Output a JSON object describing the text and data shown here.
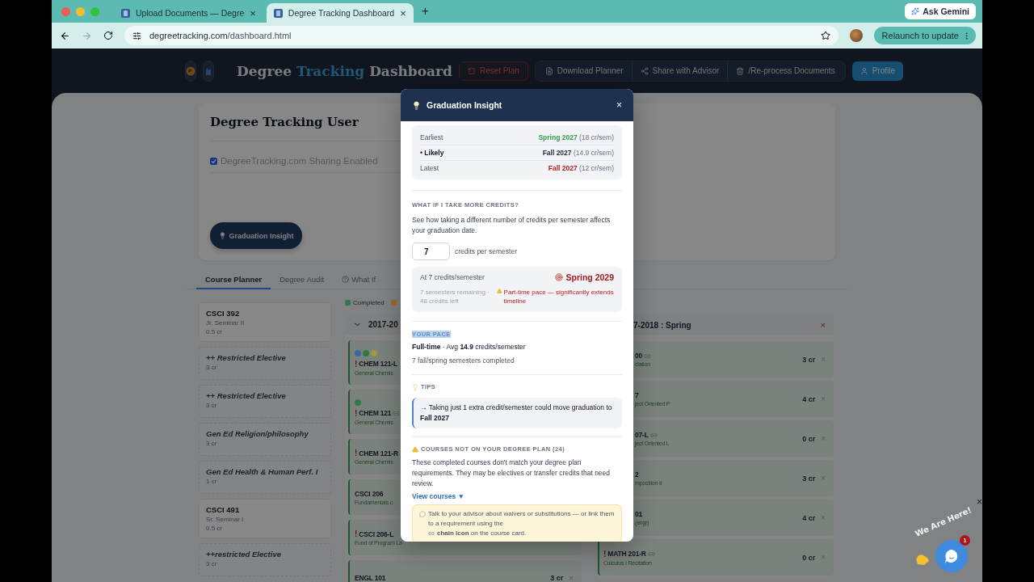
{
  "browser": {
    "tabs": [
      {
        "title": "Upload Documents — Degre",
        "close": "×",
        "selected": false
      },
      {
        "title": "Degree Tracking Dashboard",
        "close": "×",
        "selected": true
      }
    ],
    "new_tab": "+",
    "gemini": "Ask Gemini",
    "url_host": "degreetracking.com",
    "url_path": "/dashboard.html",
    "relaunch": "Relaunch to update"
  },
  "header": {
    "title_parts": [
      {
        "text": "Degree",
        "accent": false
      },
      {
        "text": "Tracking",
        "accent": true
      },
      {
        "text": "Dashboard",
        "accent": false
      }
    ],
    "buttons": [
      {
        "label": "Reset Plan",
        "kind": "danger"
      },
      {
        "label": "Download Planner",
        "kind": "group"
      },
      {
        "label": "Share with Advisor",
        "kind": "group"
      },
      {
        "label": "/Re-process Documents",
        "kind": "group"
      },
      {
        "label": "Profile",
        "kind": "primary"
      }
    ]
  },
  "user": {
    "name": "Degree Tracking User",
    "sharing": {
      "label": "DegreeTracking.com Sharing Enabled",
      "checked": true
    },
    "insight_button": "Graduation Insight"
  },
  "tabs": [
    {
      "label": "Course Planner",
      "selected": true
    },
    {
      "label": "Degree Audit",
      "selected": false
    },
    {
      "label": "What If",
      "selected": false
    }
  ],
  "requirements": [
    {
      "kind": "course",
      "code": "CSCI 392",
      "title": "Jr. Seminar II",
      "credits": "0.5 cr"
    },
    {
      "kind": "elective",
      "title": "++ Restricted Elective",
      "credits": "3 cr"
    },
    {
      "kind": "elective",
      "title": "++ Restricted Elective",
      "credits": "3 cr"
    },
    {
      "kind": "elective",
      "title": "Gen Ed Religion/philosophy",
      "credits": "3 cr"
    },
    {
      "kind": "elective",
      "title": "Gen Ed Health & Human Perf. I",
      "credits": "1 cr"
    },
    {
      "kind": "course",
      "code": "CSCI 491",
      "title": "Sr. Seminar I",
      "credits": "0.5 cr"
    },
    {
      "kind": "elective",
      "title": "++restricted Elective",
      "credits": "3 cr"
    }
  ],
  "legend": [
    {
      "label": "Completed",
      "color": "#2f7a4a"
    },
    {
      "color": "#a06a30"
    }
  ],
  "semesters": [
    {
      "title": "2017-20",
      "expanded": true,
      "courses": [
        {
          "flag": "!",
          "code": "CHEM 121-L",
          "title": "General Chemis",
          "dots": [
            {
              "color": "#3f65a0"
            },
            {
              "color": "#2f7a3c"
            },
            {
              "color": "#9c9a3a"
            }
          ]
        },
        {
          "flag": "!",
          "code": "CHEM 121",
          "linked": true,
          "title": "General Chemis",
          "dots": [
            {
              "color": "#2f7a3c"
            }
          ]
        },
        {
          "flag": "!",
          "code": "CHEM 121-R",
          "title": "General Chemis"
        },
        {
          "code": "CSCI 206",
          "title": "Fundamentals c"
        },
        {
          "flag": "!",
          "code": "CSCI 206-L",
          "title": "Fund of Program La"
        },
        {
          "code": "ENGL 101",
          "credits": "3 cr",
          "remove": "×"
        }
      ]
    },
    {
      "title": "7-2018 : Spring",
      "remove": "×",
      "courses": [
        {
          "code": "00",
          "linked": true,
          "title": "ciation",
          "credits": "3 cr",
          "remove": "×"
        },
        {
          "code": "7",
          "title": "ject Oriented P",
          "credits": "4 cr",
          "remove": "×"
        },
        {
          "code": "07-L",
          "linked": true,
          "title": "ject Oriented L",
          "credits": "0 cr",
          "remove": "×"
        },
        {
          "code": "2",
          "title": "mposition II",
          "credits": "3 cr",
          "remove": "×"
        },
        {
          "code": "01",
          "title": "(engr)",
          "credits": "4 cr",
          "remove": "×"
        },
        {
          "flag": "!",
          "code": "MATH 201-R",
          "linked": true,
          "title": "Calculus I Recitation",
          "credits": "0 cr",
          "remove": "×"
        }
      ]
    }
  ],
  "modal": {
    "title": "Graduation Insight",
    "close": "×",
    "estimates": [
      {
        "label": "Earliest",
        "date": "Spring 2027",
        "rate": "(18 cr/sem)",
        "color": "#2e9d45",
        "emphasis": false
      },
      {
        "label": "• Likely",
        "date": "Fall 2027",
        "rate": "(14.9 cr/sem)",
        "color": "#1f2937",
        "emphasis": true
      },
      {
        "label": "Latest",
        "date": "Fall 2027",
        "rate": "(12 cr/sem)",
        "color": "#b91c1c",
        "emphasis": false
      }
    ],
    "what_if": {
      "heading": "WHAT IF I TAKE MORE CREDITS?",
      "text": "See how taking a different number of credits per semester affects your graduation date.",
      "credits_value": "7",
      "credits_label": "credits per semester",
      "result": {
        "label": "At 7 credits/semester",
        "date": "Spring 2029",
        "details": "7 semesters remaining · 48 credits left",
        "warning": "Part-time pace — significantly extends timeline"
      }
    },
    "pace": {
      "heading": "YOUR PACE",
      "highlighted": true,
      "summary": "**Full-time** · Avg **14.9** credits/semester",
      "completed": "7 fall/spring semesters completed"
    },
    "tips": {
      "heading": "TIPS",
      "items": [
        "→ Taking just 1 extra credit/semester could move graduation to **Fall 2027**"
      ]
    },
    "unplanned": {
      "heading": "COURSES NOT ON YOUR DEGREE PLAN (24)",
      "text": "These completed courses don't match your degree plan requirements. They may be electives or transfer credits that need review.",
      "link": "View courses ▼",
      "note_before": "Talk to your advisor about waivers or substitutions — or link them to a requirement using the",
      "note_after": "**chain icon** on the course card."
    }
  },
  "chat": {
    "label": "We Are Here!",
    "badge": "1",
    "close": "×"
  }
}
